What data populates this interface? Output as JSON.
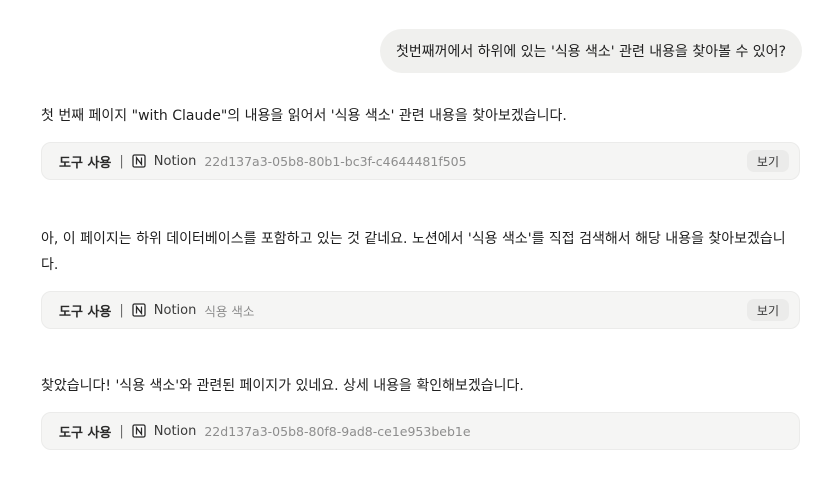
{
  "user_message": "첫번째꺼에서 하위에 있는 '식용 색소' 관련 내용을 찾아볼 수 있어?",
  "assistant": [
    {
      "text": "첫 번째 페이지 \"with Claude\"의 내용을 읽어서 '식용 색소' 관련 내용을 찾아보겠습니다.",
      "tool": {
        "label": "도구 사용",
        "separator": "|",
        "icon": "notion-icon",
        "name": "Notion",
        "arg": "22d137a3-05b8-80b1-bc3f-c4644481f505",
        "view_label": "보기"
      }
    },
    {
      "text": "아, 이 페이지는 하위 데이터베이스를 포함하고 있는 것 같네요. 노션에서 '식용 색소'를 직접 검색해서 해당 내용을 찾아보겠습니다.",
      "tool": {
        "label": "도구 사용",
        "separator": "|",
        "icon": "notion-icon",
        "name": "Notion",
        "arg": "식용 색소",
        "view_label": "보기"
      }
    },
    {
      "text": "찾았습니다! '식용 색소'와 관련된 페이지가 있네요. 상세 내용을 확인해보겠습니다.",
      "tool": {
        "label": "도구 사용",
        "separator": "|",
        "icon": "notion-icon",
        "name": "Notion",
        "arg": "22d137a3-05b8-80f8-9ad8-ce1e953beb1e"
      }
    }
  ]
}
